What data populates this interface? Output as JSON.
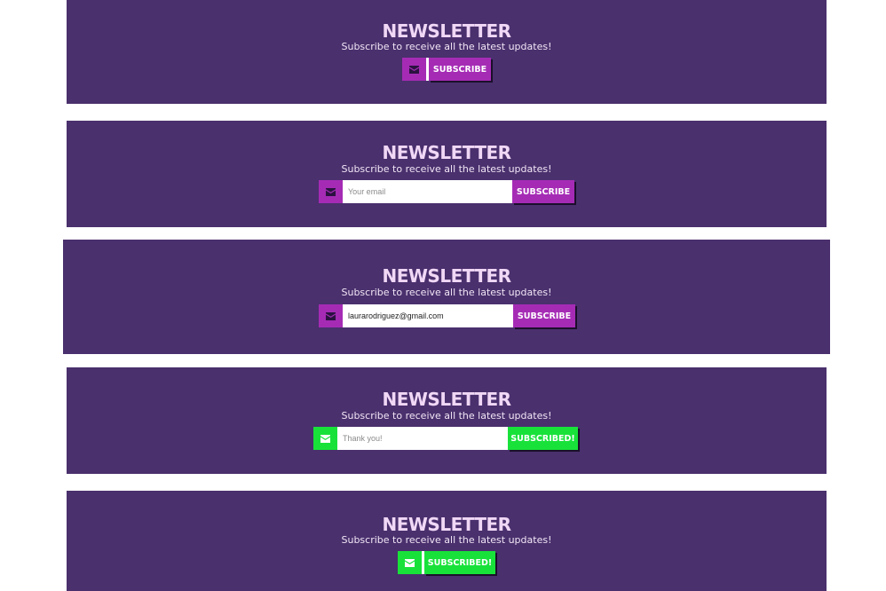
{
  "colors": {
    "panel_bg": "#4a306d",
    "accent_purple": "#a52bb5",
    "accent_green": "#18e23a",
    "title_text": "#f0d8f6"
  },
  "states": [
    {
      "title": "NEWSLETTER",
      "subtitle": "Subscribe to receive all the latest updates!",
      "icon": "envelope-icon",
      "button_label": "SUBSCRIBE"
    },
    {
      "title": "NEWSLETTER",
      "subtitle": "Subscribe to receive all the latest updates!",
      "icon": "envelope-icon",
      "input_placeholder": "Your email",
      "input_value": "",
      "button_label": "SUBSCRIBE"
    },
    {
      "title": "NEWSLETTER",
      "subtitle": "Subscribe to receive all the latest updates!",
      "icon": "envelope-icon",
      "input_placeholder": "Your email",
      "input_value": "laurarodriguez@gmail.com",
      "button_label": "SUBSCRIBE"
    },
    {
      "title": "NEWSLETTER",
      "subtitle": "Subscribe to receive all the latest updates!",
      "icon": "envelope-icon",
      "input_placeholder": "Thank you!",
      "input_value": "",
      "button_label": "SUBSCRIBED!"
    },
    {
      "title": "NEWSLETTER",
      "subtitle": "Subscribe to receive all the latest updates!",
      "icon": "envelope-icon",
      "button_label": "SUBSCRIBED!"
    }
  ]
}
